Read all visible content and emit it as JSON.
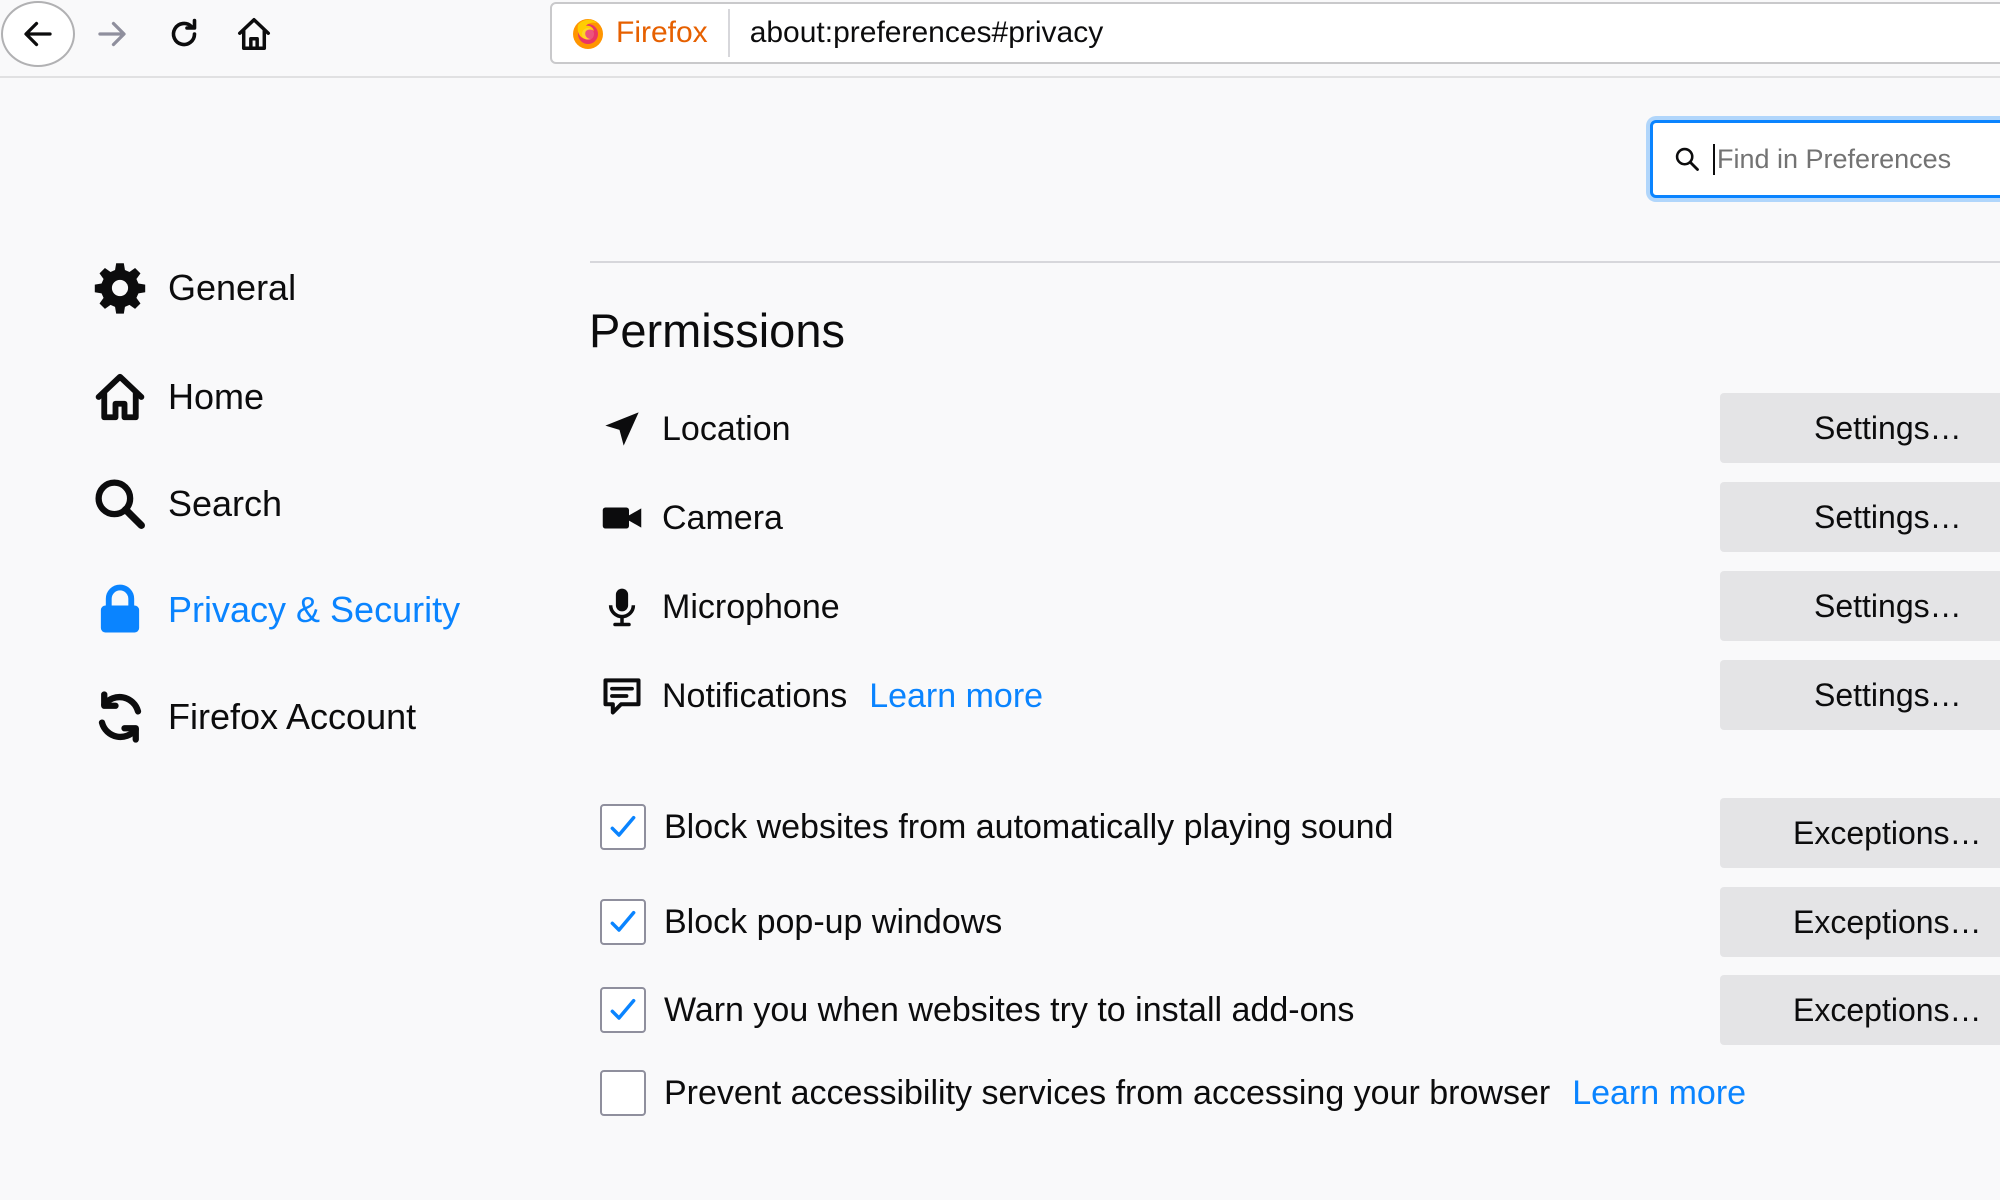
{
  "toolbar": {
    "identity_label": "Firefox",
    "url": "about:preferences#privacy"
  },
  "search": {
    "placeholder": "Find in Preferences"
  },
  "sidebar": {
    "items": [
      {
        "label": "General",
        "icon": "gear-icon"
      },
      {
        "label": "Home",
        "icon": "home-icon"
      },
      {
        "label": "Search",
        "icon": "search-icon"
      },
      {
        "label": "Privacy & Security",
        "icon": "lock-icon",
        "selected": true
      },
      {
        "label": "Firefox Account",
        "icon": "sync-icon"
      }
    ]
  },
  "permissions": {
    "title": "Permissions",
    "rows": [
      {
        "label": "Location",
        "icon": "location-arrow-icon",
        "button": "Settings…"
      },
      {
        "label": "Camera",
        "icon": "camera-icon",
        "button": "Settings…"
      },
      {
        "label": "Microphone",
        "icon": "microphone-icon",
        "button": "Settings…"
      },
      {
        "label": "Notifications",
        "icon": "notification-bubble-icon",
        "button": "Settings…",
        "link": "Learn more"
      }
    ],
    "checkboxes": [
      {
        "label": "Block websites from automatically playing sound",
        "checked": true,
        "button": "Exceptions…"
      },
      {
        "label": "Block pop-up windows",
        "checked": true,
        "button": "Exceptions…"
      },
      {
        "label": "Warn you when websites try to install add-ons",
        "checked": true,
        "button": "Exceptions…"
      },
      {
        "label": "Prevent accessibility services from accessing your browser",
        "checked": false,
        "link": "Learn more"
      }
    ]
  },
  "colors": {
    "accent": "#0a84ff",
    "brand": "#e66000",
    "background": "#f9f9fa",
    "button": "#e4e4e6"
  }
}
